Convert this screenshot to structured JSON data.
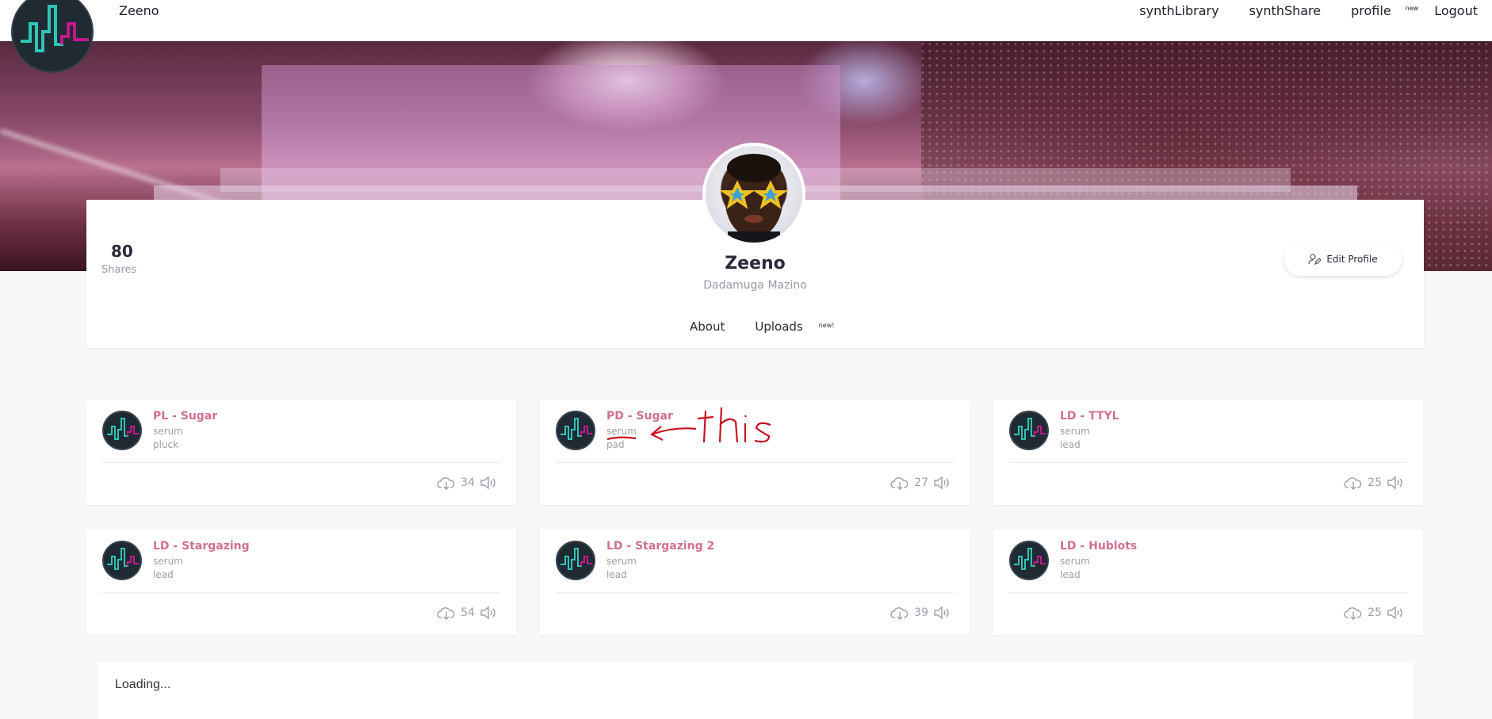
{
  "nav": {
    "brand": "Zeeno",
    "links": [
      {
        "label": "synthLibrary"
      },
      {
        "label": "synthShare"
      },
      {
        "label": "profile",
        "badge": "new"
      },
      {
        "label": "Logout"
      }
    ]
  },
  "profile": {
    "shares_count": "80",
    "shares_label": "Shares",
    "display_name": "Zeeno",
    "real_name": "Dadamuga Mazino",
    "edit_label": "Edit Profile",
    "tabs": [
      {
        "label": "About"
      },
      {
        "label": "Uploads",
        "badge": "new!"
      }
    ]
  },
  "presets": [
    {
      "title": "PL - Sugar",
      "synth": "serum",
      "type": "pluck",
      "downloads": "34"
    },
    {
      "title": "PD - Sugar",
      "synth": "serum",
      "type": "pad",
      "downloads": "27"
    },
    {
      "title": "LD - TTYL",
      "synth": "serum",
      "type": "lead",
      "downloads": "25"
    },
    {
      "title": "LD - Stargazing",
      "synth": "serum",
      "type": "lead",
      "downloads": "54"
    },
    {
      "title": "LD - Stargazing 2",
      "synth": "serum",
      "type": "lead",
      "downloads": "39"
    },
    {
      "title": "LD - Hublots",
      "synth": "serum",
      "type": "lead",
      "downloads": "25"
    }
  ],
  "loading_text": "Loading...",
  "icons": {
    "download": "cloud-download-icon",
    "play": "speaker-icon",
    "edit": "user-edit-icon"
  },
  "colors": {
    "accent_pink": "#d0708c",
    "logo_teal": "#2ec4b6",
    "logo_magenta": "#c2188c",
    "badge_red": "#e0304a"
  }
}
